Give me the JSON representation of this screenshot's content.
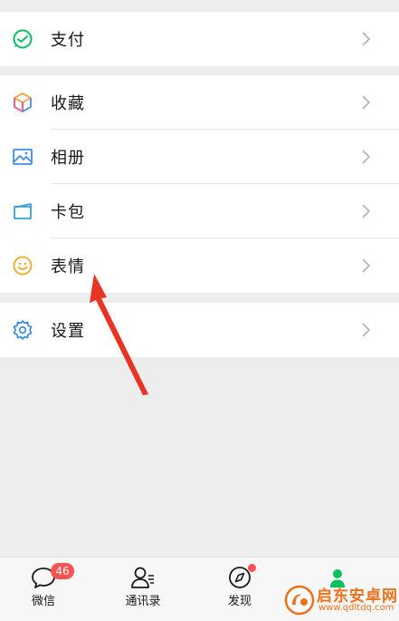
{
  "menu": {
    "pay": {
      "label": "支付",
      "icon": "wechat-pay-icon"
    },
    "favorites": {
      "label": "收藏",
      "icon": "cube-icon"
    },
    "album": {
      "label": "相册",
      "icon": "image-icon"
    },
    "cards": {
      "label": "卡包",
      "icon": "card-icon"
    },
    "stickers": {
      "label": "表情",
      "icon": "smiley-icon"
    },
    "settings": {
      "label": "设置",
      "icon": "gear-icon"
    }
  },
  "tabbar": {
    "chats": {
      "label": "微信",
      "badge": "46"
    },
    "contacts": {
      "label": "通讯录"
    },
    "discover": {
      "label": "发现"
    }
  },
  "watermark": {
    "text": "启东安卓网",
    "url": "www.qdltdq.com"
  },
  "colors": {
    "accent": "#07c160",
    "badge": "#fa5151",
    "arrow": "#ea3323",
    "background": "#ededed"
  }
}
